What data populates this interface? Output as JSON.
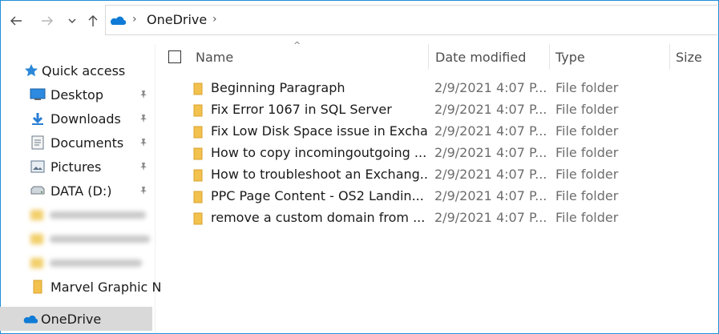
{
  "address": {
    "location": "OneDrive"
  },
  "sidebar": {
    "quick_access": "Quick access",
    "items": [
      {
        "label": "Desktop",
        "icon": "desktop-icon"
      },
      {
        "label": "Downloads",
        "icon": "downloads-icon"
      },
      {
        "label": "Documents",
        "icon": "documents-icon"
      },
      {
        "label": "Pictures",
        "icon": "pictures-icon"
      },
      {
        "label": "DATA (D:)",
        "icon": "drive-icon"
      }
    ],
    "marvel": "Marvel Graphic N",
    "onedrive": "OneDrive"
  },
  "columns": {
    "name": "Name",
    "date": "Date modified",
    "type": "Type",
    "size": "Size"
  },
  "files": [
    {
      "name": "Beginning Paragraph",
      "date": "2/9/2021 4:07 P...",
      "type": "File folder"
    },
    {
      "name": "Fix Error 1067 in SQL Server",
      "date": "2/9/2021 4:07 P...",
      "type": "File folder"
    },
    {
      "name": "Fix Low Disk Space issue in Excha...",
      "date": "2/9/2021 4:07 P...",
      "type": "File folder"
    },
    {
      "name": "How to copy incomingoutgoing ...",
      "date": "2/9/2021 4:07 P...",
      "type": "File folder"
    },
    {
      "name": "How to troubleshoot an Exchang...",
      "date": "2/9/2021 4:07 P...",
      "type": "File folder"
    },
    {
      "name": "PPC Page Content - OS2 Landin...",
      "date": "2/9/2021 4:07 P...",
      "type": "File folder"
    },
    {
      "name": "remove a custom domain from ...",
      "date": "2/9/2021 4:07 P...",
      "type": "File folder"
    }
  ],
  "colors": {
    "accent": "#1f8fd8",
    "folder": "#f2c14e",
    "selected": "#d9d9d9"
  }
}
